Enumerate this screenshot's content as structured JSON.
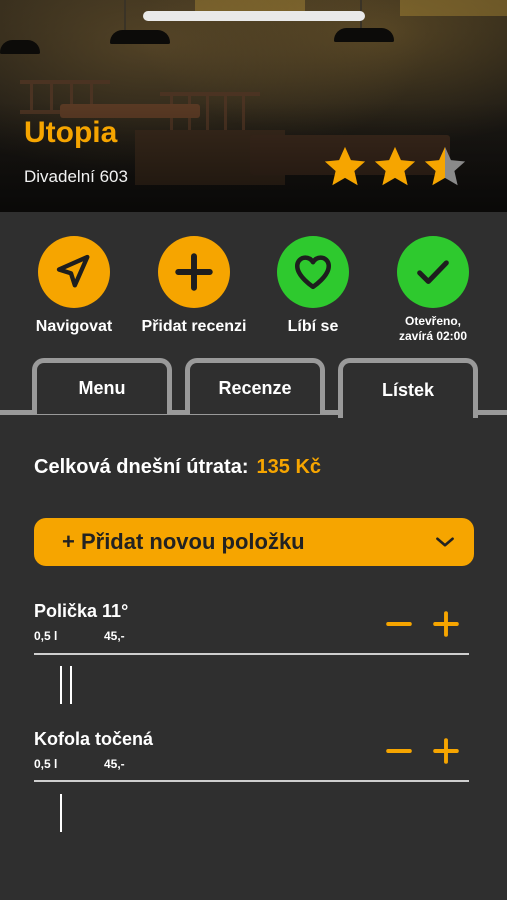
{
  "venue": {
    "name": "Utopia",
    "address": "Divadelní 603",
    "rating": 2.5,
    "rating_max": 3
  },
  "colors": {
    "accent": "#f6a500",
    "green": "#2ec92e",
    "background": "#2f2f2f",
    "tab_border": "#9a9a9a"
  },
  "actions": [
    {
      "label": "Navigovat",
      "icon": "navigation-arrow-icon",
      "color": "#f6a500"
    },
    {
      "label": "Přidat recenzi",
      "icon": "plus-icon",
      "color": "#f6a500"
    },
    {
      "label": "Líbí se",
      "icon": "heart-icon",
      "color": "#2ec92e"
    },
    {
      "label_line1": "Otevřeno,",
      "label_line2": "zavírá 02:00",
      "icon": "checkmark-icon",
      "color": "#2ec92e"
    }
  ],
  "tabs": [
    {
      "label": "Menu",
      "active": false
    },
    {
      "label": "Recenze",
      "active": false
    },
    {
      "label": "Lístek",
      "active": true
    }
  ],
  "summary": {
    "label": "Celková dnešní útrata:",
    "value": "135 Kč"
  },
  "add_item": {
    "label": "+ Přidat novou položku",
    "icon": "chevron-down-icon"
  },
  "items": [
    {
      "name": "Polička 11°",
      "volume": "0,5 l",
      "price": "45,-",
      "count": 2
    },
    {
      "name": "Kofola točená",
      "volume": "0,5 l",
      "price": "45,-",
      "count": 1
    }
  ]
}
